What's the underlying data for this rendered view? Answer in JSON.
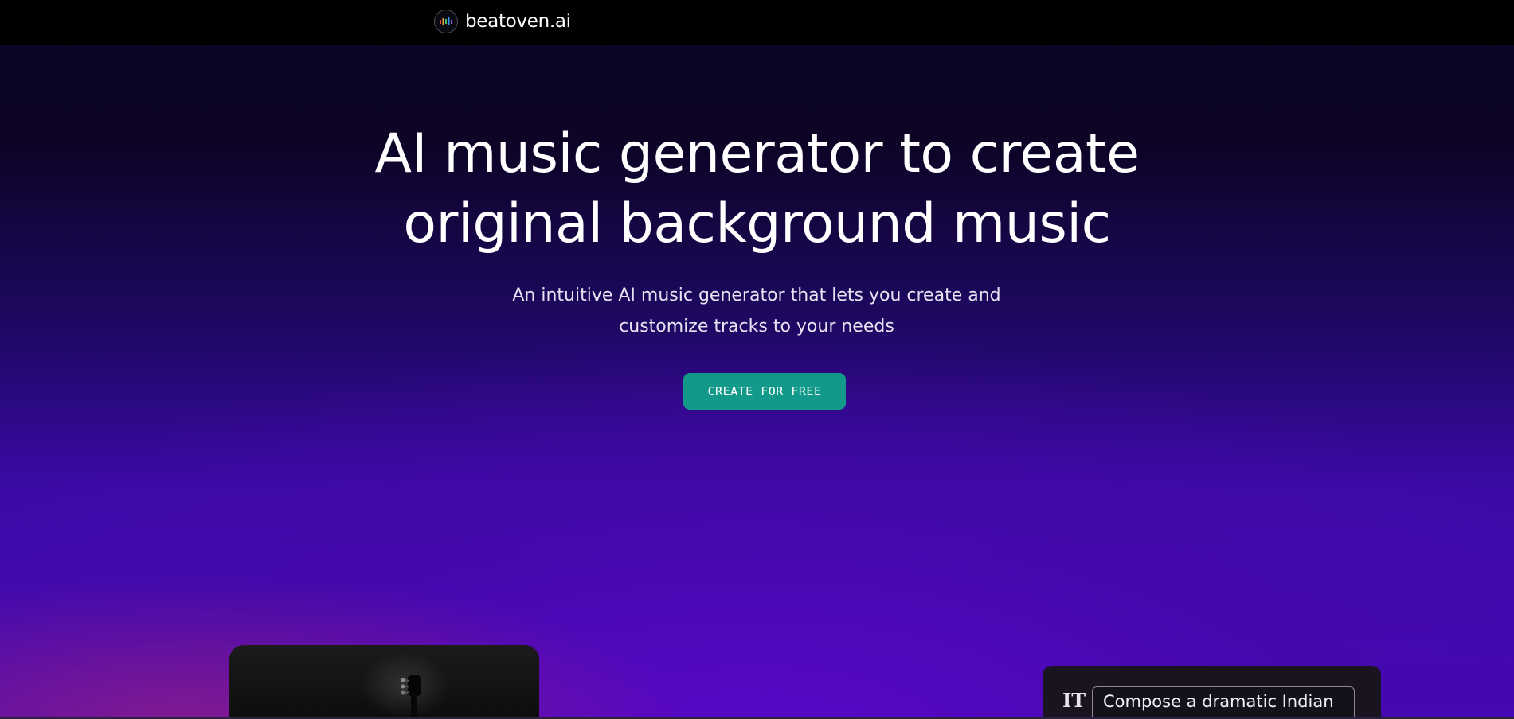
{
  "brand": {
    "name": "beatoven.ai",
    "logo_icon": "equalizer-bars-icon",
    "logo_colors": [
      "#e8443a",
      "#f2a23a",
      "#3fc27a",
      "#3a8fe8",
      "#9b5de5"
    ]
  },
  "hero": {
    "title_line1": "AI music generator to create",
    "title_line2": "original background music",
    "subtitle_line1": "An intuitive AI music generator that lets you create and",
    "subtitle_line2": "customize tracks to your needs",
    "cta_label": "CREATE FOR FREE"
  },
  "prompt_card": {
    "tool_icon": "text-tool-icon",
    "tool_glyph": "IT",
    "input_text": "Compose a dramatic Indian"
  },
  "colors": {
    "accent": "#13998a",
    "topbar": "#000000",
    "purple": "#4408b8"
  }
}
